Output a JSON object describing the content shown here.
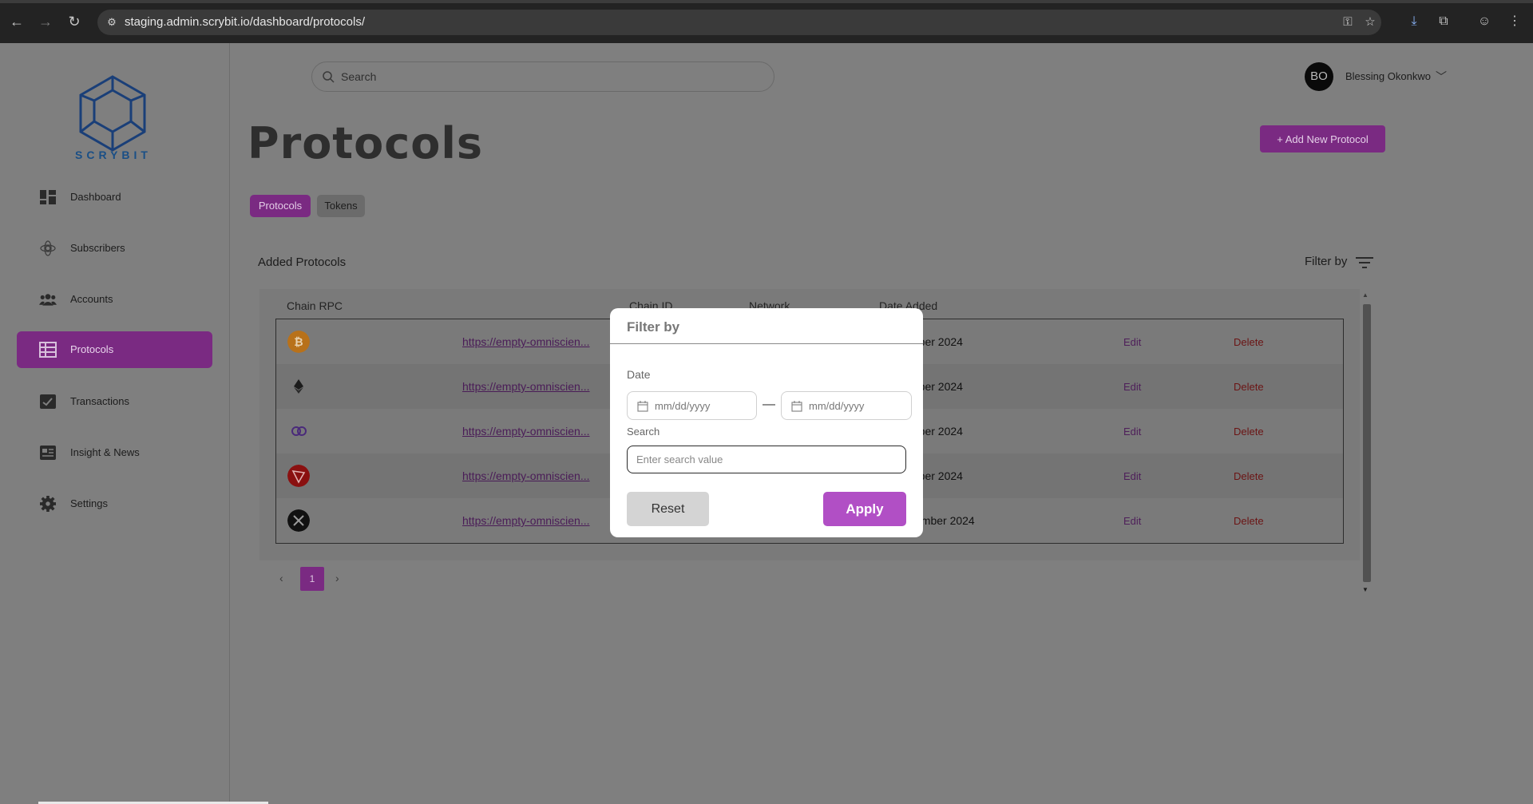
{
  "browser": {
    "url": "staging.admin.scrybit.io/dashboard/protocols/"
  },
  "sidebar": {
    "logo_text": "SCRYBIT",
    "items": [
      {
        "label": "Dashboard",
        "icon": "dashboard-icon"
      },
      {
        "label": "Subscribers",
        "icon": "subscribers-icon"
      },
      {
        "label": "Accounts",
        "icon": "accounts-icon"
      },
      {
        "label": "Protocols",
        "icon": "protocols-icon",
        "active": true
      },
      {
        "label": "Transactions",
        "icon": "transactions-icon"
      },
      {
        "label": "Insight & News",
        "icon": "news-icon"
      },
      {
        "label": "Settings",
        "icon": "settings-icon"
      }
    ]
  },
  "header": {
    "search_placeholder": "Search",
    "user_initials": "BO",
    "user_name": "Blessing Okonkwo"
  },
  "page": {
    "title": "Protocols",
    "add_button": "+ Add New Protocol",
    "tabs": [
      "Protocols",
      "Tokens"
    ],
    "section_title": "Added Protocols",
    "filter_label": "Filter by"
  },
  "table": {
    "columns": [
      "Chain RPC",
      "Chain ID",
      "Network",
      "Date Added"
    ],
    "rows": [
      {
        "icon": "bitcoin-icon",
        "rpc": "https://empty-omniscien...",
        "date": "tober 2024",
        "edit": "Edit",
        "delete": "Delete"
      },
      {
        "icon": "ethereum-icon",
        "rpc": "https://empty-omniscien...",
        "date": "tober 2024",
        "edit": "Edit",
        "delete": "Delete"
      },
      {
        "icon": "polygon-icon",
        "rpc": "https://empty-omniscien...",
        "date": "tober 2024",
        "edit": "Edit",
        "delete": "Delete"
      },
      {
        "icon": "tron-icon",
        "rpc": "https://empty-omniscien...",
        "date": "tober 2024",
        "edit": "Edit",
        "delete": "Delete"
      },
      {
        "icon": "xrp-icon",
        "rpc": "https://empty-omniscien...",
        "date": "vember 2024",
        "edit": "Edit",
        "delete": "Delete"
      }
    ]
  },
  "pagination": {
    "prev": "‹",
    "current": "1",
    "next": "›"
  },
  "modal": {
    "title": "Filter by",
    "date_label": "Date",
    "date_from_placeholder": "mm/dd/yyyy",
    "date_to_placeholder": "mm/dd/yyyy",
    "date_separator": "—",
    "search_label": "Search",
    "search_placeholder": "Enter search value",
    "reset_label": "Reset",
    "apply_label": "Apply"
  },
  "colors": {
    "accent": "#7a2a82",
    "apply": "#b14fc5",
    "delete": "#6b1414"
  }
}
